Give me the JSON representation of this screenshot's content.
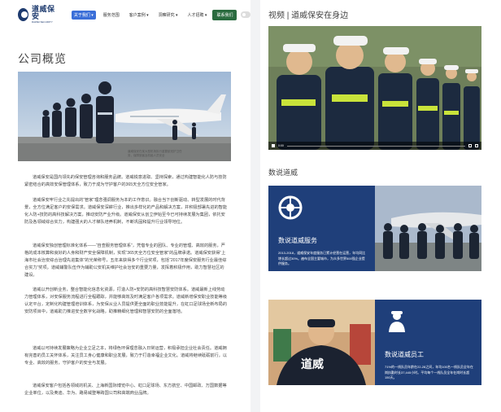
{
  "nav": {
    "logo_cn": "道威保安",
    "logo_en": "DAWEI SECURITY",
    "items": [
      {
        "label": "关于我们 ▾",
        "active": true
      },
      {
        "label": "服务范围",
        "active": false
      },
      {
        "label": "客户案例 ▾",
        "active": false
      },
      {
        "label": "洞察研究 ▾",
        "active": false
      },
      {
        "label": "人才招聘 ▾",
        "active": false
      }
    ],
    "contact_label": "联系我们"
  },
  "left": {
    "title": "公司概览",
    "hero_caption": "道威保安在某大型机场执行重要航班护卫任务，保障旅客及机组人员安全",
    "paragraphs": [
      "道威保安是国内领先的保安管理咨询和服务品牌。道威锐意进取、坚持探索，通过构建智能化人防与技防紧密结合的高效安保管理体系，致力于成为守护客户的365天全方位安全管家。",
      "道威保安牢行业之先提出的“管家”理念强调服务为本的工作意识。融合当下创新驱动、转型发展的时代背景，全方位满足客户的安保需求。道威保安深耕行业，推出多样化的产品和解决方案，并积极部署先进的智能化人防+技防的高科技解决方案，推动安防产业升级。道威保安从创立伊始至今已可持续发展为集团，依托安防及各领域综合实力，构建强大的人才梯队培养机制，不断巩固和提升行业领导地位。",
      "道威保安独创管理标准化体系——“自查服务管理体系”，凭借专业的团队、专业的管理、高效的服务，严格的成本核算和良好的人身和财产安全保障机制，实现“365天全方位安全管家”的品牌承诺。道威保安获得“上海市社会治安综合治理先进集体”的光荣称号，五年来获得多个行业奖项，包括“2017年度保安服务行业最佳综合实力”奖项。道威辅警队伍作为辅助公安机关维护社会治安的重要力量，发挥着积极作用，助力智慧社区的建设。",
      "道威以开创新业务，整合智能化信息化资源，打造人防+安防的高科技智慧安防体系。道威最新上线劳动力管理体系，对安保服务流程进行全程跟踪，并能够高效及时满足客户各项需求。道威新增保安职业技能等级认定平台，定制化构建管理培训体系，为安保从业人员提供更全面的职业技能提升，在虹口足球场全新布局的安防项目中，道威助力推进安全数字化战略，助推精细化管理和智慧安防的全面落地。",
      "道威以可持续发展策略为企业立足之本，将绿色环保理念融入日常运营，积极承担企业社会责任。道威拥有完善的员工关怀体系，关注员工身心健康和职业发展，致力于打造幸福企业文化。道威将继续砥砺前行，以专业、高效的服务，守护客户的安全与发展。",
      "道威保安客户包括各领域的机关、上海新国际博览中心、虹口足球场、东方航空、中国邮政、万国数据等企业单位，以及奥迪、华为、路易威登等跨国公司和高端商业品牌。"
    ]
  },
  "right": {
    "video_title": "视频 | 道威保安在身边",
    "video_time": "0:00",
    "section_title": "数说道威",
    "card1": {
      "icon": "wheel-icon",
      "title": "数说道威服务",
      "desc": "2013-2018，道威保安年度服务已累计经营在运营，年均同比增长超过30%。遍布全国主要城市，为众多世界500强企业提供服务。"
    },
    "card2": {
      "icon": "guard-icon",
      "title": "数说道威员工",
      "desc": "71%的一线队员年龄在22-28之间，年均100名一线队员全年在岗执勤时长37,440小时。平均每个一线队员全年在岗时长超150天。"
    }
  },
  "colors": {
    "brand_navy": "#1f3f7a",
    "nav_active": "#3b6fd8",
    "contact_green": "#2a6b3f"
  }
}
